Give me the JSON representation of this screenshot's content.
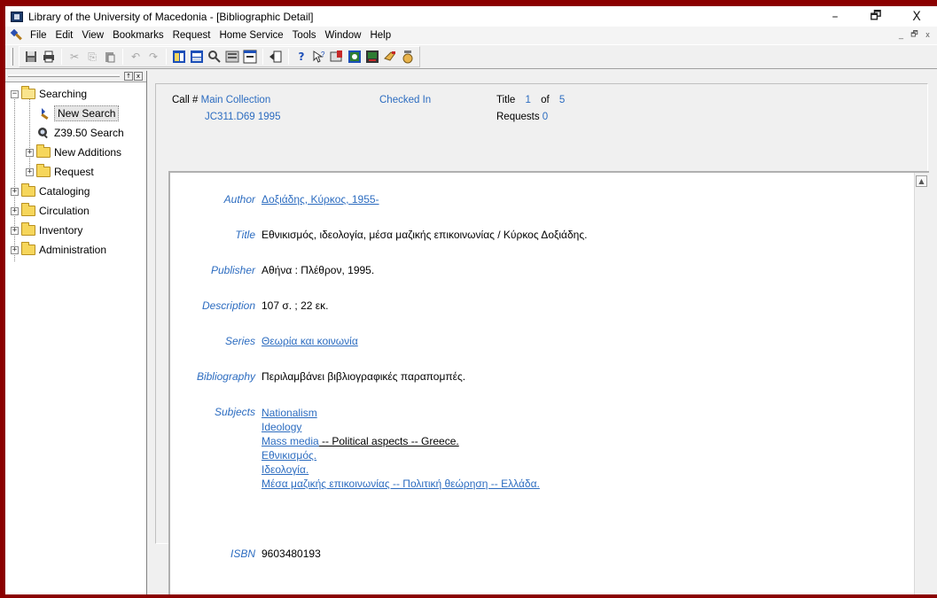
{
  "window": {
    "title": "Library of the University of Macedonia - [Bibliographic Detail]",
    "minimize": "–",
    "restore": "🗗",
    "close": "X"
  },
  "menu": {
    "items": [
      "File",
      "Edit",
      "View",
      "Bookmarks",
      "Request",
      "Home Service",
      "Tools",
      "Window",
      "Help"
    ],
    "mdi": [
      "_",
      "🗗",
      "x"
    ]
  },
  "toolbar": {
    "icons": [
      "save-icon",
      "print-icon",
      "cut-icon",
      "copy-icon",
      "paste-icon",
      "undo-icon",
      "redo-icon",
      "view-icon-1",
      "view-icon-2",
      "search-tool-icon",
      "view-icon-3",
      "view-icon-4",
      "back-icon",
      "help-icon",
      "whatsthis-icon",
      "bookmark-icon",
      "capture-icon",
      "screen-icon",
      "hand-icon",
      "info-icon"
    ]
  },
  "sidebar": {
    "buttons": [
      "↑",
      "x"
    ],
    "tree": [
      {
        "label": "Searching",
        "level": 0,
        "kind": "folder-open",
        "exp": "−"
      },
      {
        "label": "New Search",
        "level": 1,
        "kind": "search",
        "selected": true
      },
      {
        "label": "Z39.50 Search",
        "level": 1,
        "kind": "z3950"
      },
      {
        "label": "New Additions",
        "level": 1,
        "kind": "folder",
        "exp": "+"
      },
      {
        "label": "Request",
        "level": 1,
        "kind": "folder",
        "exp": "+"
      },
      {
        "label": "Cataloging",
        "level": 0,
        "kind": "folder",
        "exp": "+"
      },
      {
        "label": "Circulation",
        "level": 0,
        "kind": "folder",
        "exp": "+"
      },
      {
        "label": "Inventory",
        "level": 0,
        "kind": "folder",
        "exp": "+"
      },
      {
        "label": "Administration",
        "level": 0,
        "kind": "folder",
        "exp": "+"
      }
    ]
  },
  "header": {
    "call_label": "Call #",
    "collection": "Main Collection",
    "call_number": "JC311.D69 1995",
    "status": "Checked In",
    "title_label": "Title",
    "title_index": "1",
    "of_label": "of",
    "title_total": "5",
    "requests_label": "Requests",
    "requests_count": "0"
  },
  "record": {
    "author_label": "Author",
    "author": "Δοξιάδης, Κύρκος, 1955-",
    "title_label": "Title",
    "title": "Εθνικισμός, ιδεολογία, μέσα μαζικής επικοινωνίας / Κύρκος Δοξιάδης.",
    "publisher_label": "Publisher",
    "publisher": "Αθήνα : Πλέθρον, 1995.",
    "description_label": "Description",
    "description": "107 σ. ; 22 εκ.",
    "series_label": "Series",
    "series": "Θεωρία και κοινωνία",
    "bibliography_label": "Bibliography",
    "bibliography": "Περιλαμβάνει βιβλιογραφικές παραπομπές.",
    "subjects_label": "Subjects",
    "subjects": {
      "s1": "Nationalism",
      "s2": "Ideology",
      "s3_link": "Mass media",
      "s3_rest": " -- Political aspects -- Greece.",
      "s4": "Εθνικισμός.",
      "s5": "Ιδεολογία.",
      "s6": "Μέσα μαζικής επικοινωνίας -- Πολιτική θεώρηση -- Ελλάδα."
    },
    "isbn_label": "ISBN",
    "isbn": "9603480193"
  },
  "colors": {
    "link": "#2c6cc0",
    "frame": "#8b0000",
    "folder": "#f6d65b"
  }
}
